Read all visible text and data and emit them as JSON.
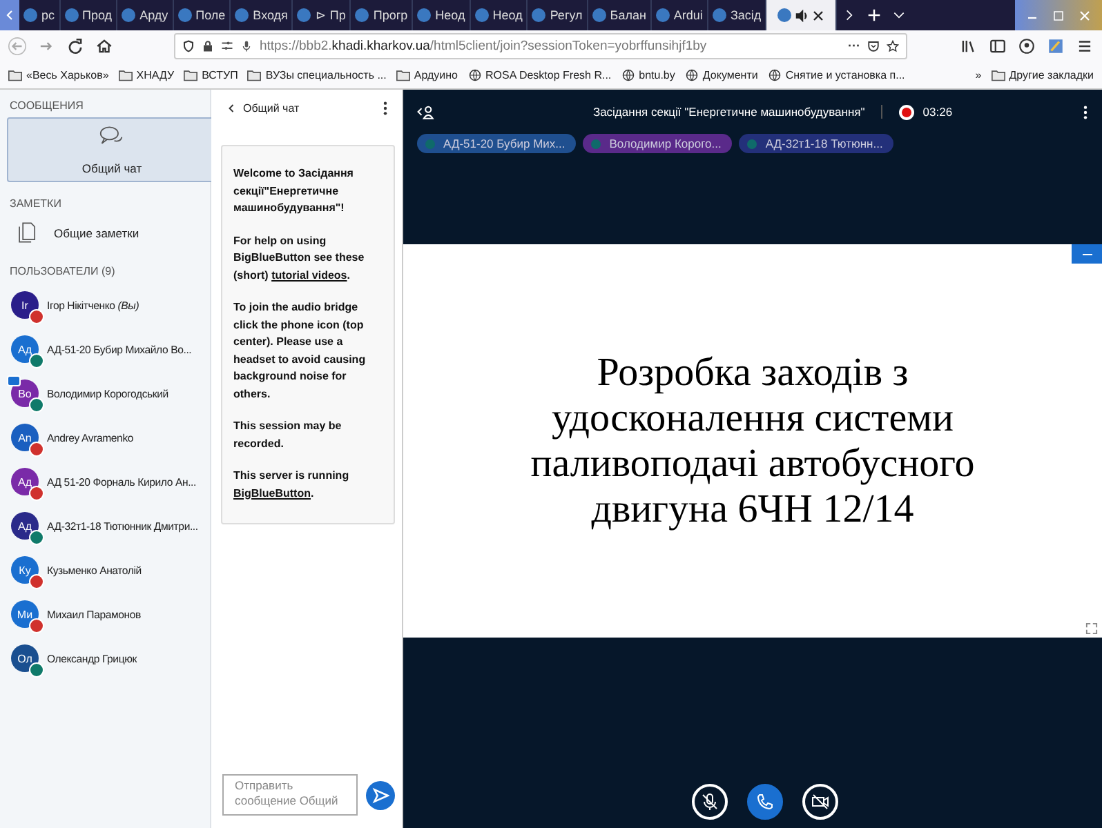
{
  "browser": {
    "tabs": [
      {
        "label": "рс",
        "selected": false
      },
      {
        "label": "Прод",
        "selected": false
      },
      {
        "label": "Арду",
        "selected": false
      },
      {
        "label": "Поле",
        "selected": false
      },
      {
        "label": "Входя",
        "selected": false
      },
      {
        "label": "⊳ Пр",
        "selected": false
      },
      {
        "label": "Прогр",
        "selected": false
      },
      {
        "label": "Неод",
        "selected": false
      },
      {
        "label": "Неод",
        "selected": false
      },
      {
        "label": "Регул",
        "selected": false
      },
      {
        "label": "Балан",
        "selected": false
      },
      {
        "label": "Ardui",
        "selected": false
      },
      {
        "label": "Засід",
        "selected": false
      },
      {
        "selected": true
      }
    ],
    "url": "https://bbb2.**khadi.kharkov.ua**/html5client/join?sessionToken=yobrffunsihjf1by",
    "url_menu": "···",
    "bookmarks": [
      {
        "label": "«Весь Харьков»",
        "kind": "folder"
      },
      {
        "label": "ХНАДУ",
        "kind": "folder"
      },
      {
        "label": "ВСТУП",
        "kind": "folder"
      },
      {
        "label": "ВУЗы специальность ...",
        "kind": "folder"
      },
      {
        "label": "Ардуино",
        "kind": "folder"
      },
      {
        "label": "ROSA Desktop Fresh R...",
        "kind": "site"
      },
      {
        "label": "bntu.by",
        "kind": "site"
      },
      {
        "label": "Документи",
        "kind": "site"
      },
      {
        "label": "Снятие и установка п...",
        "kind": "site"
      }
    ],
    "more_bookmarks": "»",
    "other_bookmarks": "Другие закладки"
  },
  "sidebar": {
    "messages_heading": "СООБЩЕНИЯ",
    "chat_item": {
      "label": "Общий чат",
      "selected": true
    },
    "notes_heading": "ЗАМЕТКИ",
    "notes_item": "Общие заметки",
    "users_heading": "ПОЛЬЗОВАТЕЛИ (9)",
    "users": [
      {
        "initials": "Ir",
        "name": "Ігор Нікітченко *(Вы)*",
        "color": "#2a1e8a",
        "muted": true,
        "presenter": false
      },
      {
        "initials": "Ад",
        "name": "АД-51-20 Бубир Михайло Во...",
        "color": "#1a6fd0",
        "muted": false,
        "presenter": false
      },
      {
        "initials": "Во",
        "name": "Володимир Корогодський",
        "color": "#7a2aa8",
        "muted": false,
        "presenter": true
      },
      {
        "initials": "An",
        "name": "Andrey Avramenko",
        "color": "#1a5fc0",
        "muted": true,
        "presenter": false
      },
      {
        "initials": "Ад",
        "name": "АД 51-20 Форналь Кирило Ан...",
        "color": "#7a2aa8",
        "muted": true,
        "presenter": false
      },
      {
        "initials": "Ад",
        "name": "АД-32т1-18 Тютюнник Дмитри...",
        "color": "#2a2a8a",
        "muted": false,
        "presenter": false
      },
      {
        "initials": "Ку",
        "name": "Кузьменко Анатолій",
        "color": "#1a6fd0",
        "muted": true,
        "presenter": false
      },
      {
        "initials": "Ми",
        "name": "Михаил Парамонов",
        "color": "#1a6fd0",
        "muted": true,
        "presenter": false
      },
      {
        "initials": "Ол",
        "name": "Олександр Грицюк",
        "color": "#1a4f90",
        "muted": false,
        "presenter": false
      }
    ]
  },
  "chat": {
    "title": "Общий чат",
    "welcome": [
      {
        "text": "Welcome to **Засідання секції\"Енергетичне машинобудування\"**!"
      },
      {
        "text": "For help on using BigBlueButton see these (short) ",
        "link": "tutorial videos",
        "after": "."
      },
      {
        "text": "To join the audio bridge click the phone icon (top center). Please use a headset to avoid causing background noise for others."
      },
      {
        "text": "This session may be recorded."
      },
      {
        "text": "This server is running ",
        "link": "BigBlueButton",
        "after": "."
      }
    ],
    "input": {
      "placeholder": "Отправить сообщение Общий"
    }
  },
  "presentation": {
    "title": "Засідання секції \"Енергетичне машинобудування\"",
    "recording": true,
    "time": "03:26",
    "talkers": [
      {
        "name": "АД-51-20 Бубир Мих...",
        "color": "#1f4f8f"
      },
      {
        "name": "Володимир Корого...",
        "color": "#5a2a8a"
      },
      {
        "name": "АД-32т1-18 Тютюнн...",
        "color": "#23307a"
      }
    ],
    "slide_text": "Розробка заходів з удосконалення системи паливоподачі автобусного двигуна 6ЧН 12/14",
    "controls": {
      "mic_muted": true,
      "video_off": true
    }
  }
}
